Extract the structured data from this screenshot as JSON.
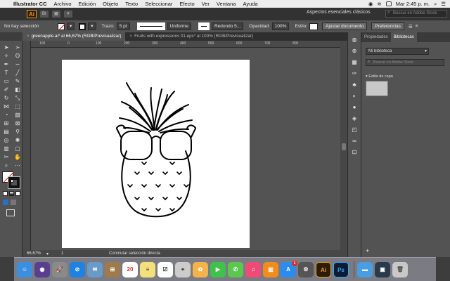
{
  "menubar": {
    "app_name": "Illustrator CC",
    "items": [
      "Archivo",
      "Edición",
      "Objeto",
      "Texto",
      "Seleccionar",
      "Efecto",
      "Ver",
      "Ventana",
      "Ayuda"
    ],
    "clock": "Mar 2:45 p. m."
  },
  "appbar": {
    "logo": "Ai",
    "workspace": "Aspectos esenciales clásicos",
    "stock_search_placeholder": "Buscar en Adobe Stock"
  },
  "controlbar": {
    "selection": "No hay selección",
    "stroke_label": "Trazo:",
    "stroke_value": "5 pt",
    "profile": "Uniforme",
    "brush": "Redondo 5...",
    "opacity_label": "Opacidad:",
    "opacity_value": "100%",
    "style_label": "Estilo:",
    "adjust_document": "Ajustar documento",
    "preferences": "Preferencias"
  },
  "tabs": [
    {
      "label": "greenapple.ai* al 66,67% (RGB/Previsualizar)",
      "active": true
    },
    {
      "label": "Fruits with expressions 01.eps* al 100% (RGB/Previsualizar)",
      "active": false
    }
  ],
  "ruler": [
    "100",
    "0",
    "100",
    "200",
    "300",
    "400",
    "500",
    "600",
    "700",
    "800"
  ],
  "statusbar": {
    "zoom": "66,67%",
    "page": "1",
    "message": "Conmutar selección directa"
  },
  "rpanel": {
    "tabs": [
      "Propiedades",
      "Bibliotecas"
    ],
    "library": "Mi biblioteca",
    "search_placeholder": "Buscar en Adobe Stock",
    "section": "▾ Estilo de capa"
  },
  "dock": {
    "calendar_day": "20",
    "appstore_badge": "1",
    "ai_label": "Ai",
    "ps_label": "Ps"
  }
}
